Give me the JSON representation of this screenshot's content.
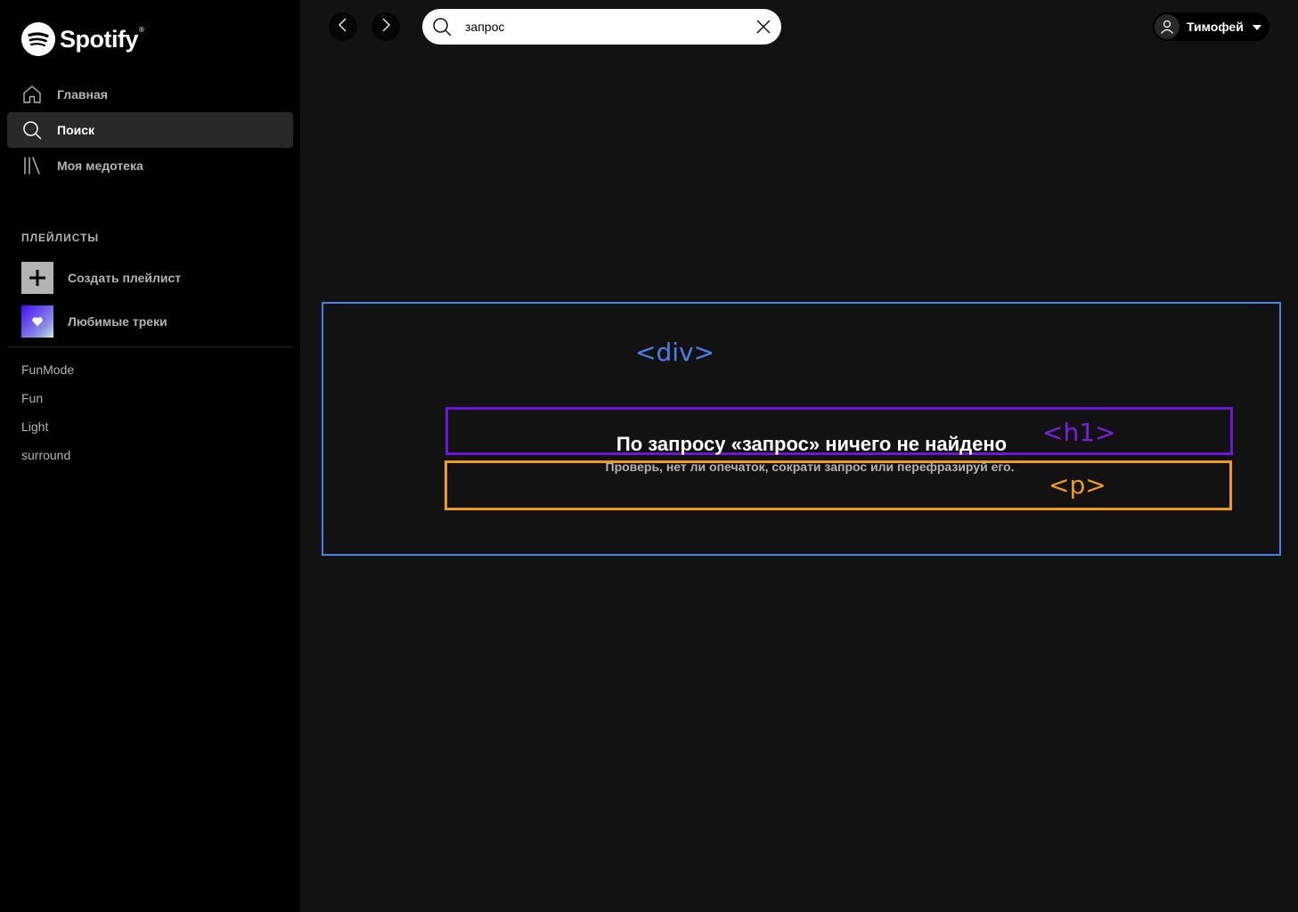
{
  "brand": {
    "name": "Spotify",
    "trademark": "®"
  },
  "nav": {
    "items": [
      {
        "label": "Главная",
        "icon": "home-icon"
      },
      {
        "label": "Поиск",
        "icon": "search-icon",
        "active": true
      },
      {
        "label": "Моя медотека",
        "icon": "library-icon"
      }
    ]
  },
  "playlists_section": {
    "header": "ПЛЕЙЛИСТЫ",
    "create_label": "Создать плейлист",
    "liked_label": "Любимые треки",
    "items": [
      "FunMode",
      "Fun",
      "Light",
      "surround"
    ]
  },
  "search": {
    "value": "запрос"
  },
  "user": {
    "name": "Тимофей"
  },
  "results": {
    "title": "По запросу «запрос» ничего не найдено",
    "text": "Проверь, нет ли опечаток, сократи запрос или перефразируй его."
  },
  "annotations": {
    "div_tag": "<div>",
    "h1_tag": "<h1>",
    "p_tag": "<p>",
    "colors": {
      "div": "#4a7fe8",
      "h1": "#6b17d6",
      "p": "#ee9a1b"
    }
  },
  "colors": {
    "sidebar_bg": "#000000",
    "main_bg": "#121212",
    "active_bg": "#282828",
    "text_muted": "#b3b3b3"
  }
}
